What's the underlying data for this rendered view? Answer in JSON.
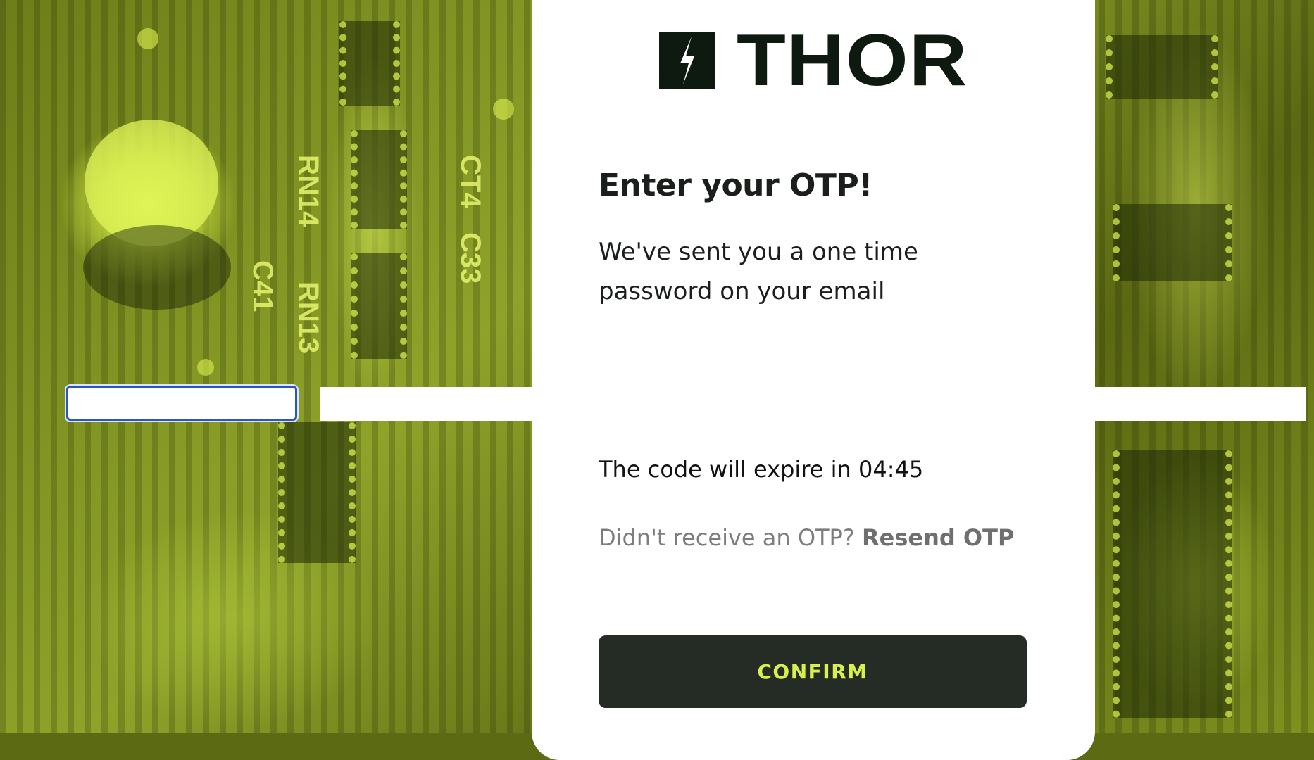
{
  "brand": {
    "name": "THOR",
    "logo_icon": "lightning-bolt-icon",
    "text_color": "#0e1a10",
    "accent_color": "#d9f04c"
  },
  "otp": {
    "heading": "Enter your OTP!",
    "subtext": "We've sent you a one time password on your email",
    "expire_prefix": "The code will expire in",
    "expire_time": "04:45",
    "resend_prompt": "Didn't receive an OTP?",
    "resend_link": "Resend OTP",
    "confirm_label": "CONFIRM"
  },
  "background": {
    "silkscreen": [
      "RN14",
      "RN13",
      "C41",
      "CT4",
      "C33"
    ]
  }
}
